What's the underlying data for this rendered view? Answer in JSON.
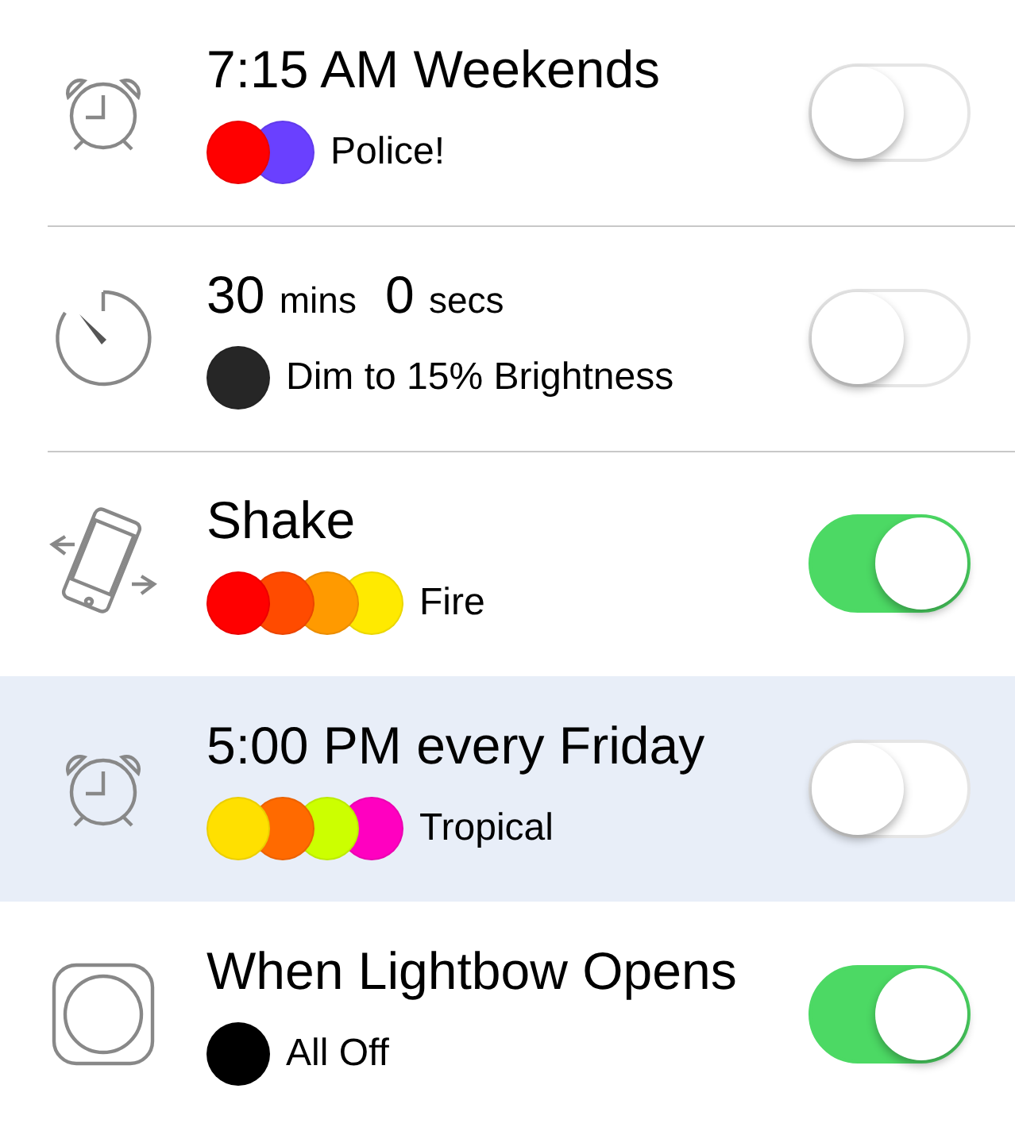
{
  "rows": [
    {
      "kind": "alarm",
      "title": [
        {
          "text": "7:15 AM Weekends",
          "kind": "main"
        }
      ],
      "scene": "Police!",
      "lights": [
        {
          "color": "#ff0000"
        },
        {
          "color": "#6a40ff"
        }
      ],
      "on": false,
      "selected": false
    },
    {
      "kind": "timer",
      "title": [
        {
          "text": "30",
          "kind": "number"
        },
        {
          "text": "mins",
          "kind": "unit"
        },
        {
          "text": "0",
          "kind": "number"
        },
        {
          "text": "secs",
          "kind": "unit"
        }
      ],
      "scene": "Dim to 15% Brightness",
      "lights": [
        {
          "color": "#262626"
        }
      ],
      "on": false,
      "selected": false
    },
    {
      "kind": "shake",
      "title": [
        {
          "text": "Shake",
          "kind": "main"
        }
      ],
      "scene": "Fire",
      "lights": [
        {
          "color": "#ff0000"
        },
        {
          "color": "#ff4b00"
        },
        {
          "color": "#ff9a00"
        },
        {
          "color": "#ffea00"
        }
      ],
      "on": true,
      "selected": false
    },
    {
      "kind": "alarm",
      "title": [
        {
          "text": "5:00 PM every Friday",
          "kind": "main"
        }
      ],
      "scene": "Tropical",
      "lights": [
        {
          "color": "#ffe000"
        },
        {
          "color": "#ff6a00"
        },
        {
          "color": "#ccff00"
        },
        {
          "color": "#ff00c0"
        }
      ],
      "on": false,
      "selected": true
    },
    {
      "kind": "app",
      "title": [
        {
          "text": "When Lightbow Opens",
          "kind": "main"
        }
      ],
      "scene": "All Off",
      "lights": [
        {
          "color": "#000000"
        }
      ],
      "on": true,
      "selected": false
    }
  ]
}
